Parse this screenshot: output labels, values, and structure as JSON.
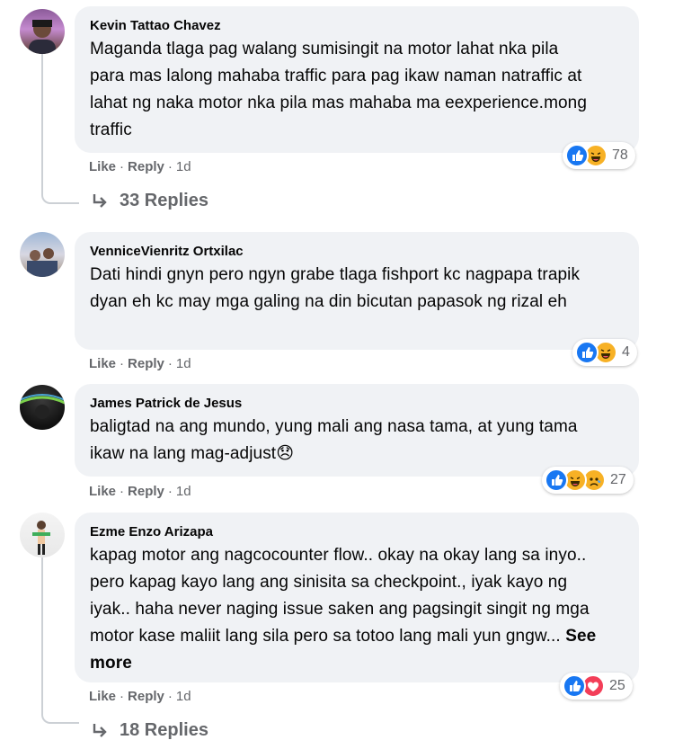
{
  "comments": [
    {
      "author": "Kevin Tattao Chavez",
      "text": "Maganda tlaga pag walang sumisingit na motor lahat nka pila para mas lalong mahaba traffic para pag ikaw naman natraffic at lahat ng naka motor nka pila mas mahaba ma eexperience.mong traffic",
      "like": "Like",
      "reply": "Reply",
      "time": "1d",
      "reaction_count": "78",
      "replies": "33 Replies"
    },
    {
      "author": "VenniceVienritz Ortxilac",
      "text": "Dati hindi gnyn pero ngyn grabe tlaga fishport kc nagpapa trapik dyan eh kc may mga galing na din bicutan papasok ng rizal eh",
      "like": "Like",
      "reply": "Reply",
      "time": "1d",
      "reaction_count": "4"
    },
    {
      "author": "James Patrick de Jesus",
      "text": "baligtad na ang mundo, yung mali ang nasa tama, at yung tama ikaw na lang mag-adjust😞",
      "like": "Like",
      "reply": "Reply",
      "time": "1d",
      "reaction_count": "27"
    },
    {
      "author": "Ezme Enzo Arizapa",
      "text": "kapag motor ang nagcocounter flow.. okay na okay lang sa inyo.. pero kapag kayo lang ang sinisita sa checkpoint., iyak kayo ng iyak.. haha never naging issue saken ang pagsingit singit ng mga motor kase maliit lang sila pero sa totoo lang mali yun gngw...",
      "see_more": "See more",
      "like": "Like",
      "reply": "Reply",
      "time": "1d",
      "reaction_count": "25",
      "replies": "18 Replies"
    }
  ],
  "separator": "·",
  "colors": {
    "bubble": "#f0f2f5",
    "meta_text": "#65676b",
    "like_blue": "#1877f2",
    "haha_yellow": "#f7b125",
    "love_red": "#f33e58"
  },
  "icons": [
    "like-reaction-icon",
    "haha-reaction-icon",
    "sad-reaction-icon",
    "love-reaction-icon",
    "reply-arrow-icon"
  ]
}
